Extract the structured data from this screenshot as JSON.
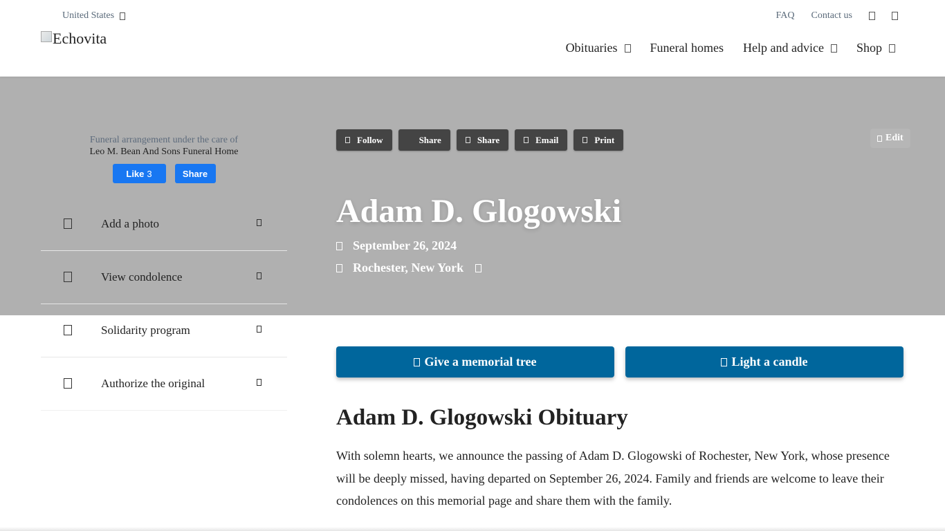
{
  "header": {
    "country": "United States",
    "logo_alt": "Echovita",
    "utility_links": [
      "FAQ",
      "Contact us"
    ],
    "nav": [
      {
        "label": "Obituaries"
      },
      {
        "label": "Funeral homes"
      },
      {
        "label": "Help and advice"
      },
      {
        "label": "Shop"
      }
    ]
  },
  "care": {
    "label": "Funeral arrangement under the care of",
    "home": "Leo M. Bean And Sons Funeral Home",
    "like_label": "Like",
    "like_count": "3",
    "share_label": "Share"
  },
  "sidebar": {
    "items": [
      {
        "label": "Add a photo"
      },
      {
        "label": "View condolence"
      },
      {
        "label": "Solidarity program"
      },
      {
        "label": "Authorize the original"
      }
    ]
  },
  "actions": {
    "follow": "Follow",
    "share_fb": "Share",
    "share": "Share",
    "email": "Email",
    "print": "Print",
    "edit": "Edit"
  },
  "obituary": {
    "name": "Adam D. Glogowski",
    "date": "September 26, 2024",
    "place": "Rochester, New York",
    "tree_button": "Give a memorial tree",
    "candle_button": "Light a candle",
    "title": "Adam D. Glogowski Obituary",
    "paragraph": "With solemn hearts, we announce the passing of Adam D. Glogowski of Rochester, New York, whose presence will be deeply missed, having departed on September 26, 2024. Family and friends are welcome to leave their condolences on this memorial page and share them with the family."
  },
  "colors": {
    "hero_bg": "#b0b0b0",
    "cta_bg": "#00669c",
    "facebook": "#1877f2",
    "action_btn": "#444444"
  }
}
